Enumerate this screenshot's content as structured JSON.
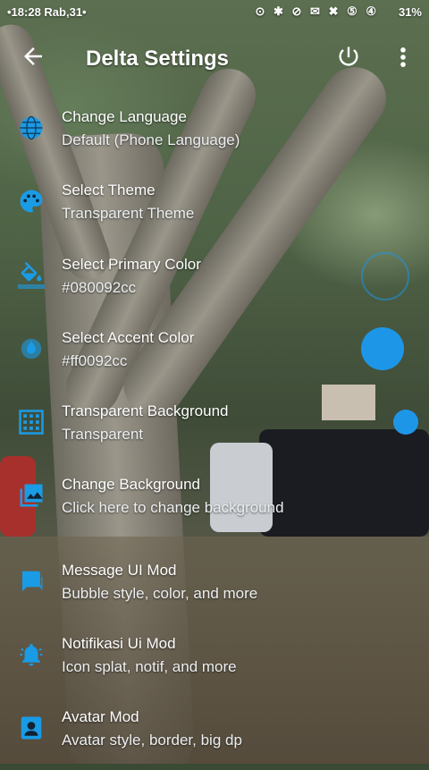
{
  "status_bar": {
    "time": "•18:28 Rab,31•",
    "icons_text": "⊙ ✱ ⊘ ✉ ✖ ⑤ ④",
    "battery": "31%"
  },
  "app_bar": {
    "title": "Delta Settings"
  },
  "colors": {
    "accent": "#1a9be6",
    "text": "#ffffff"
  },
  "settings": [
    {
      "icon": "globe-icon",
      "title": "Change Language",
      "subtitle": "Default (Phone Language)"
    },
    {
      "icon": "palette-icon",
      "title": "Select Theme",
      "subtitle": "Transparent Theme"
    },
    {
      "icon": "paint-bucket-icon",
      "title": "Select Primary Color",
      "subtitle": "#080092cc"
    },
    {
      "icon": "eyedropper-icon",
      "title": "Select Accent Color",
      "subtitle": "#ff0092cc"
    },
    {
      "icon": "wallpaper-icon",
      "title": "Transparent Background",
      "subtitle": "Transparent"
    },
    {
      "icon": "image-icon",
      "title": "Change Background",
      "subtitle": "Click here to change background"
    },
    {
      "icon": "chat-icon",
      "title": "Message UI Mod",
      "subtitle": "Bubble style, color, and more"
    },
    {
      "icon": "bell-icon",
      "title": "Notifikasi Ui Mod",
      "subtitle": "Icon splat, notif, and more"
    },
    {
      "icon": "avatar-icon",
      "title": "Avatar Mod",
      "subtitle": "Avatar style, border, big dp"
    }
  ]
}
